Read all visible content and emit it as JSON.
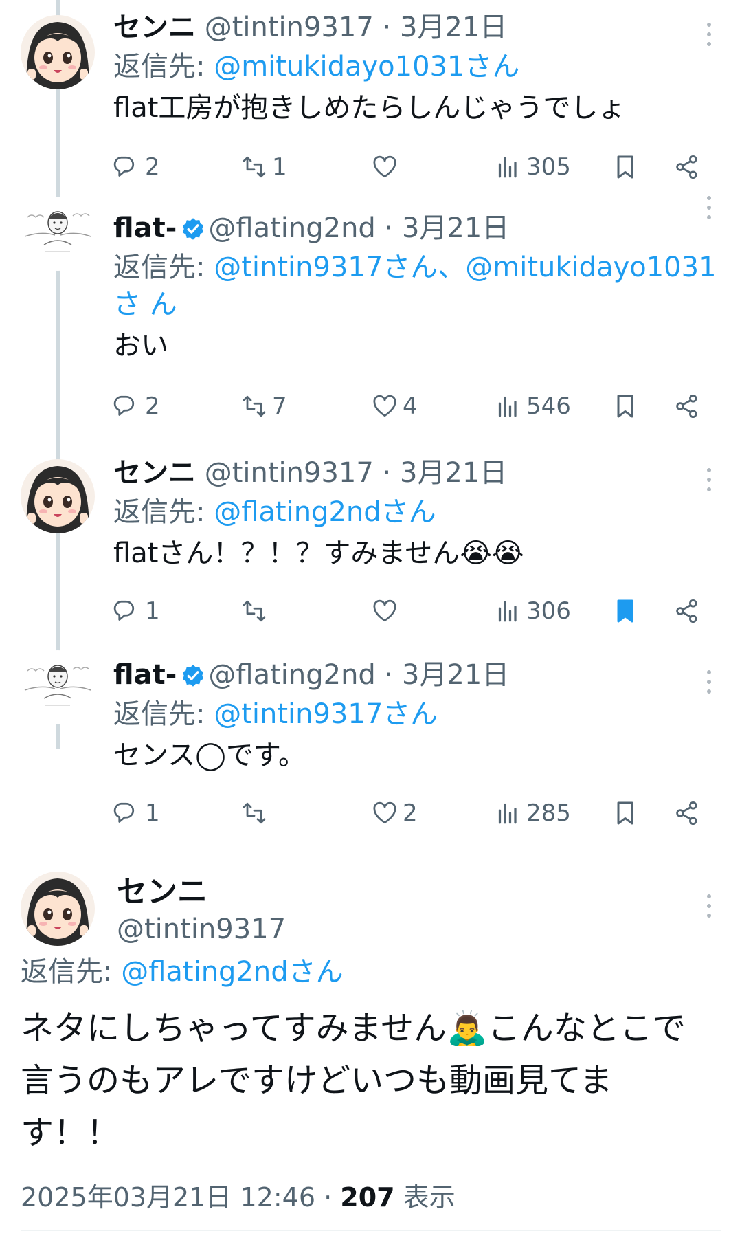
{
  "colors": {
    "accent": "#1d9bf0",
    "muted": "#536471",
    "text": "#0f1419"
  },
  "tweets": [
    {
      "name": "センニ",
      "handle": "@tintin9317",
      "date": "3月21日",
      "reply_prefix": "返信先: ",
      "reply_to": "@mitukidayo1031さん",
      "text": "flat工房が抱きしめたらしんじゃうでしょ",
      "replies": "2",
      "retweets": "1",
      "likes": "",
      "views": "305",
      "bookmarked": false,
      "verified": false,
      "avatar": "anime-girl-avatar"
    },
    {
      "name": "flat-",
      "handle": "@flating2nd",
      "date": "3月21日",
      "reply_prefix": "返信先: ",
      "reply_to": "@tintin9317さん、@mitukidayo1031さ ん",
      "text": "おい",
      "replies": "2",
      "retweets": "7",
      "likes": "4",
      "views": "546",
      "bookmarked": false,
      "verified": true,
      "avatar": "sketch-man-avatar"
    },
    {
      "name": "センニ",
      "handle": "@tintin9317",
      "date": "3月21日",
      "reply_prefix": "返信先: ",
      "reply_to": "@flating2ndさん",
      "text": "flatさん！？！？すみません😭😭",
      "replies": "1",
      "retweets": "",
      "likes": "",
      "views": "306",
      "bookmarked": true,
      "verified": false,
      "avatar": "anime-girl-avatar"
    },
    {
      "name": "flat-",
      "handle": "@flating2nd",
      "date": "3月21日",
      "reply_prefix": "返信先: ",
      "reply_to": "@tintin9317さん",
      "text": "センス◯です。",
      "replies": "1",
      "retweets": "",
      "likes": "2",
      "views": "285",
      "bookmarked": false,
      "verified": true,
      "avatar": "sketch-man-avatar"
    }
  ],
  "main": {
    "name": "センニ",
    "handle": "@tintin9317",
    "reply_prefix": "返信先: ",
    "reply_to": "@flating2ndさん",
    "text": "ネタにしちゃってすみません🙇‍♂️こんなとこで言うのもアレですけどいつも動画見てます！！",
    "timestamp": "2025年03月21日 12:46",
    "views": "207",
    "views_label": "表示"
  }
}
